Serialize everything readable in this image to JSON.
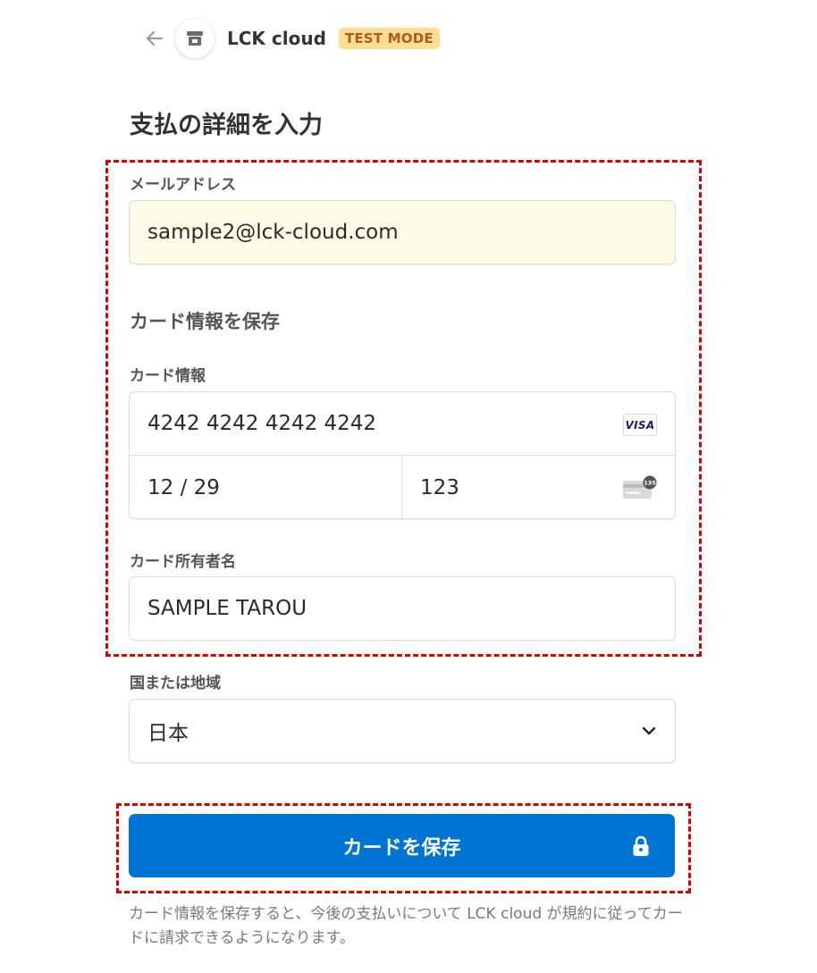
{
  "header": {
    "brand_name": "LCK cloud",
    "test_badge": "TEST MODE",
    "back_icon": "arrow-left-icon",
    "store_icon": "store-icon"
  },
  "page_title": "支払の詳細を入力",
  "email": {
    "label": "メールアドレス",
    "value": "sample2@lck-cloud.com"
  },
  "card_section_title": "カード情報を保存",
  "card": {
    "label": "カード情報",
    "number": "4242 4242 4242 4242",
    "brand": "VISA",
    "expiry": "12 / 29",
    "cvc": "123",
    "cvc_icon_digits": "135"
  },
  "cardholder": {
    "label": "カード所有者名",
    "value": "SAMPLE TAROU"
  },
  "country": {
    "label": "国または地域",
    "selected": "日本"
  },
  "save_button": {
    "label": "カードを保存",
    "icon": "lock-icon"
  },
  "footnote": "カード情報を保存すると、今後の支払いについて LCK cloud が規約に従ってカードに請求できるようになります。",
  "colors": {
    "accent": "#0074d4",
    "highlight_dashes": "#d90000",
    "test_badge_bg": "#ffde92",
    "test_badge_text": "#b3591c",
    "autofill_bg": "#fdfbe6"
  }
}
